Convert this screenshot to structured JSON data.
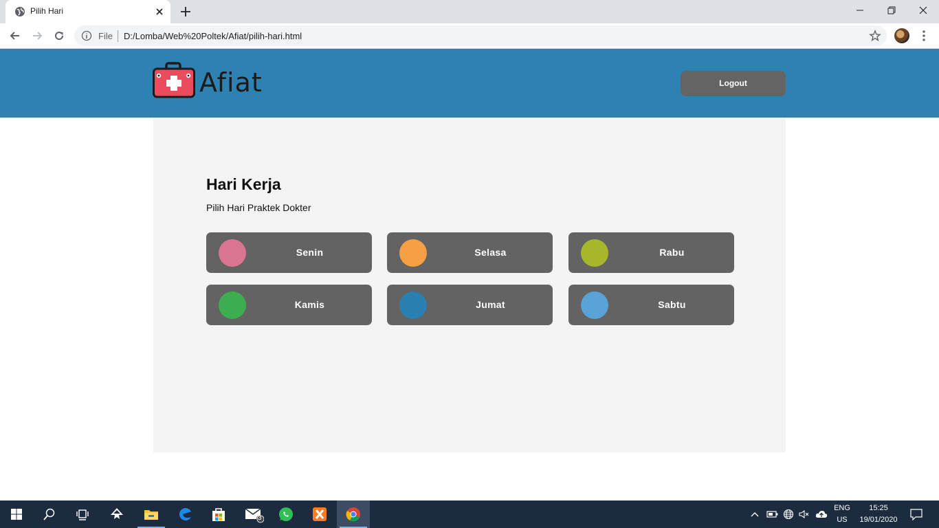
{
  "browser": {
    "tab_title": "Pilih Hari",
    "omnibox_scheme": "File",
    "omnibox_url": "D:/Lomba/Web%20Poltek/Afiat/pilih-hari.html"
  },
  "site": {
    "logo_text": "Afiat",
    "logout_label": "Logout"
  },
  "main": {
    "title": "Hari Kerja",
    "subtitle": "Pilih Hari Praktek Dokter",
    "days": [
      {
        "label": "Senin",
        "color": "#d97590"
      },
      {
        "label": "Selasa",
        "color": "#f6a043"
      },
      {
        "label": "Rabu",
        "color": "#a9b72a"
      },
      {
        "label": "Kamis",
        "color": "#3cae4f"
      },
      {
        "label": "Jumat",
        "color": "#2a80b0"
      },
      {
        "label": "Sabtu",
        "color": "#5aa3d6"
      }
    ]
  },
  "taskbar": {
    "mail_badge": "3",
    "lang_top": "ENG",
    "lang_bottom": "US",
    "time": "15:25",
    "date": "19/01/2020"
  },
  "colors": {
    "header": "#2e82b1",
    "card": "#636363",
    "panel": "#f4f4f4"
  }
}
